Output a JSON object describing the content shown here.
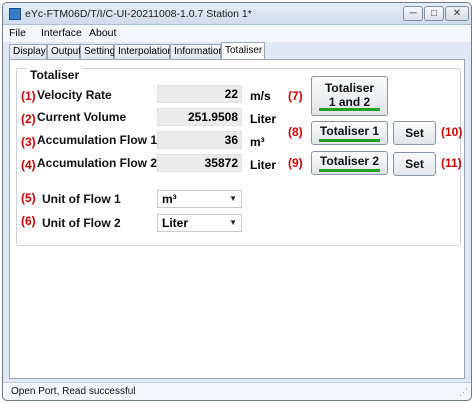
{
  "window": {
    "title": "eYc-FTM06D/T/I/C-UI-20211008-1.0.7  Station 1*",
    "controls": {
      "minimize": "─",
      "maximize": "□",
      "close": "✕"
    }
  },
  "menu": [
    "File",
    "Interface",
    "About"
  ],
  "tabs": [
    "Display",
    "Output",
    "Setting",
    "Interpolation",
    "Information",
    "Totaliser"
  ],
  "active_tab": "Totaliser",
  "group_title": "Totaliser",
  "rows": [
    {
      "num": "(1)",
      "label": "Velocity Rate",
      "value": "22",
      "unit": "m/s"
    },
    {
      "num": "(2)",
      "label": "Current Volume",
      "value": "251.9508",
      "unit": "Liter"
    },
    {
      "num": "(3)",
      "label": "Accumulation Flow 1",
      "value": "36",
      "unit": "m³"
    },
    {
      "num": "(4)",
      "label": "Accumulation Flow 2",
      "value": "35872",
      "unit": "Liter"
    }
  ],
  "units": [
    {
      "num": "(5)",
      "label": "Unit of Flow 1",
      "selected": "m³"
    },
    {
      "num": "(6)",
      "label": "Unit of Flow 2",
      "selected": "Liter"
    }
  ],
  "buttons": {
    "both": {
      "num": "(7)",
      "line1": "Totaliser",
      "line2": "1 and 2"
    },
    "t1": {
      "num": "(8)",
      "label": "Totaliser 1"
    },
    "set1": {
      "num": "(10)",
      "label": "Set"
    },
    "t2": {
      "num": "(9)",
      "label": "Totaliser 2"
    },
    "set2": {
      "num": "(11)",
      "label": "Set"
    }
  },
  "status": "Open Port,   Read successful",
  "colors": {
    "accent_red": "#d00000",
    "indicator_green": "#23a023"
  }
}
